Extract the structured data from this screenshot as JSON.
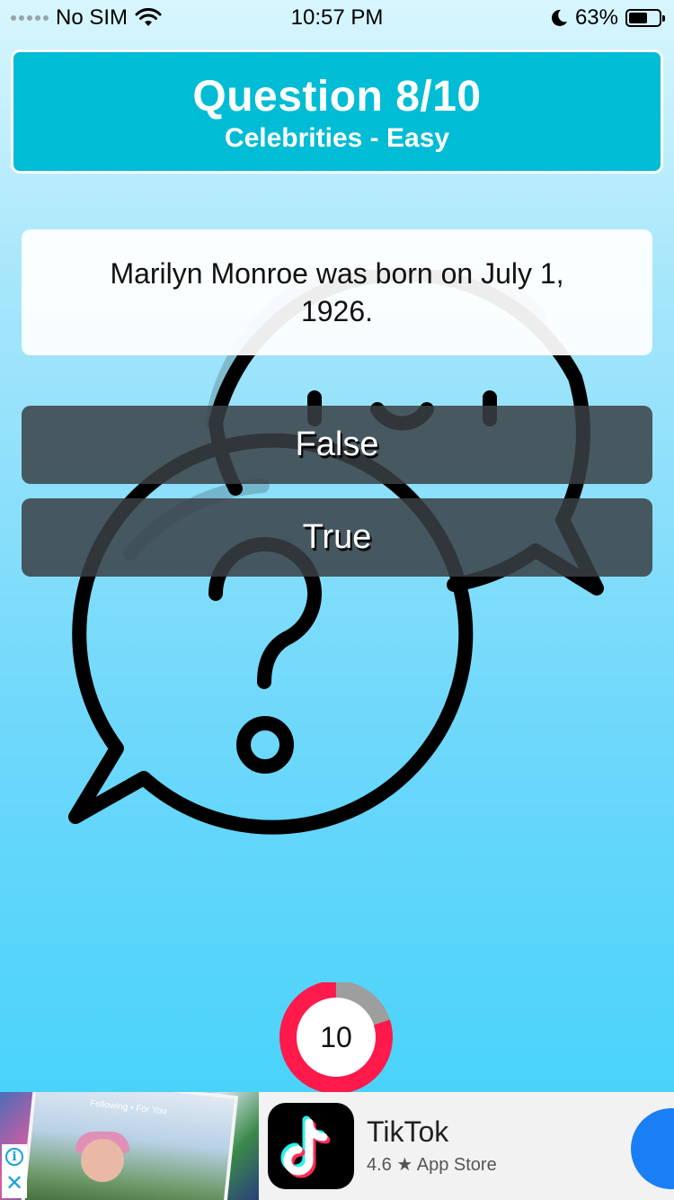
{
  "status_bar": {
    "carrier": "No SIM",
    "time": "10:57 PM",
    "battery_percent": "63%",
    "battery_level": 0.63,
    "icons": [
      "signal-dots-icon",
      "wifi-icon",
      "moon-icon",
      "battery-icon"
    ]
  },
  "header": {
    "title": "Question 8/10",
    "subtitle": "Celebrities - Easy",
    "color": "#00bcd4"
  },
  "question": {
    "text": "Marilyn Monroe was born on July 1, 1926."
  },
  "answers": [
    {
      "label": "False"
    },
    {
      "label": "True"
    }
  ],
  "timer": {
    "value": "10",
    "remaining_fraction": 0.8,
    "ring_color": "#ff1a4b",
    "elapsed_color": "#9e9e9e"
  },
  "ad": {
    "app_name": "TikTok",
    "rating": "4.6",
    "star": "★",
    "store": "App Store",
    "photo_text": "Following • For You",
    "icons": [
      "info-icon",
      "close-icon",
      "tiktok-logo-icon"
    ],
    "cta_color": "#1a7ef5"
  }
}
